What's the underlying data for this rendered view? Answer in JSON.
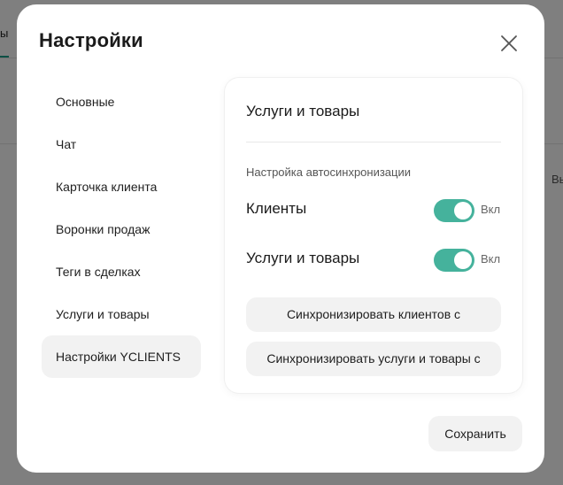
{
  "background": {
    "tab_fragment": "ы",
    "right_fragment": "Вы"
  },
  "modal": {
    "title": "Настройки",
    "close_icon": "close-icon"
  },
  "sidebar": {
    "items": [
      {
        "label": "Основные",
        "active": false
      },
      {
        "label": "Чат",
        "active": false
      },
      {
        "label": "Карточка клиента",
        "active": false
      },
      {
        "label": "Воронки продаж",
        "active": false
      },
      {
        "label": "Теги в сделках",
        "active": false
      },
      {
        "label": "Услуги и товары",
        "active": false
      },
      {
        "label": "Настройки YCLIENTS",
        "active": true
      }
    ]
  },
  "panel": {
    "title": "Услуги и товары",
    "subtitle": "Настройка автосинхронизации",
    "toggles": [
      {
        "label": "Клиенты",
        "state": "Вкл",
        "on": true
      },
      {
        "label": "Услуги и товары",
        "state": "Вкл",
        "on": true
      }
    ],
    "sync_clients_label": "Синхронизировать клиентов с",
    "sync_services_label": "Синхронизировать услуги и товары с"
  },
  "footer": {
    "save_label": "Сохранить"
  },
  "colors": {
    "accent": "#45b29c",
    "button_bg": "#f2f2f2",
    "overlay": "rgba(0,0,0,0.5)"
  }
}
